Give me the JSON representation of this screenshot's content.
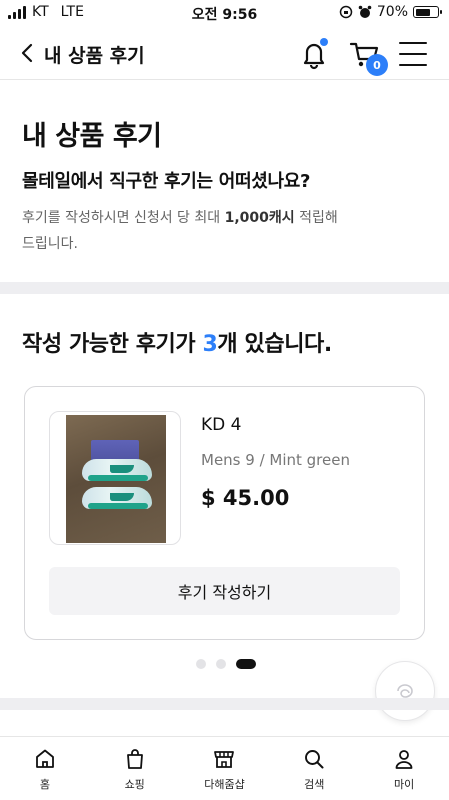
{
  "status_bar": {
    "carrier": "KT",
    "network": "LTE",
    "time": "오전 9:56",
    "battery": "70%",
    "battery_level": 0.7
  },
  "header": {
    "title": "내 상품 후기",
    "cart_count": "0"
  },
  "intro": {
    "title": "내 상품 후기",
    "subtitle": "몰테일에서 직구한 후기는 어떠셨나요?",
    "desc_prefix": "후기를 작성하시면 신청서 당 최대 ",
    "desc_highlight": "1,000캐시",
    "desc_suffix": " 적립해드립니다."
  },
  "reviews": {
    "heading_prefix": "작성 가능한 후기가 ",
    "count": "3",
    "heading_suffix": "개 있습니다.",
    "current_page": 3,
    "total_pages": 3,
    "item": {
      "name": "KD 4",
      "option": "Mens 9 / Mint green",
      "price": "$ 45.00",
      "button_label": "후기 작성하기"
    }
  },
  "bottom_nav": [
    {
      "label": "홈",
      "icon": "home-icon"
    },
    {
      "label": "쇼핑",
      "icon": "shopping-bag-icon"
    },
    {
      "label": "다해줌샵",
      "icon": "store-icon"
    },
    {
      "label": "검색",
      "icon": "search-icon"
    },
    {
      "label": "마이",
      "icon": "user-icon"
    }
  ],
  "colors": {
    "accent": "#2d7ff9",
    "divider": "#eeeef1",
    "button_bg": "#f3f3f5"
  }
}
